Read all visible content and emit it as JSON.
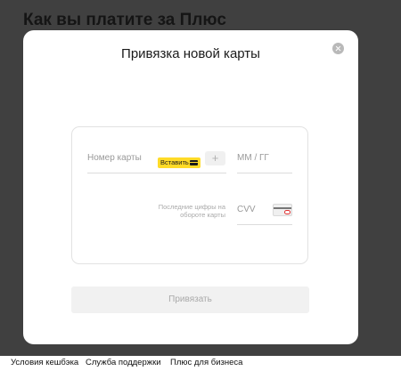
{
  "page": {
    "header_stub": "",
    "title": "Как вы платите за Плюс"
  },
  "modal": {
    "title": "Привязка новой карты",
    "card_number_placeholder": "Номер карты",
    "paste_label": "Вставить",
    "scan_label": "+",
    "expiry_placeholder": "ММ / ГГ",
    "cvv_hint": "Последние цифры на обороте карты",
    "cvv_placeholder": "CVV",
    "submit_label": "Привязать"
  },
  "footer": {
    "links": [
      "Условия кешбэка",
      "Служба поддержки",
      "Плюс для бизнеса"
    ]
  },
  "colors": {
    "overlay": "#404040",
    "accent_yellow": "#ffdb28",
    "cvv_mark_red": "#e03131"
  },
  "icons": [
    "close-icon",
    "card-icon",
    "plus-icon",
    "card-back-icon"
  ]
}
